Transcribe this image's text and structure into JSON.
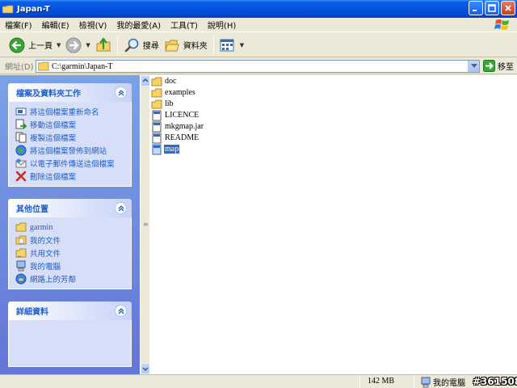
{
  "window": {
    "title": "Japan-T"
  },
  "menubar": {
    "items": [
      "檔案(F)",
      "編輯(E)",
      "檢視(V)",
      "我的最愛(A)",
      "工具(T)",
      "說明(H)"
    ]
  },
  "toolbar": {
    "back_label": "上一頁",
    "search_label": "搜尋",
    "folders_label": "資料夾"
  },
  "addressbar": {
    "label": "網址(D)",
    "path": "C:\\garmin\\Japan-T",
    "go_label": "移至"
  },
  "taskpane": {
    "file_tasks": {
      "title": "檔案及資料夾工作",
      "items": [
        "將這個檔案重新命名",
        "移動這個檔案",
        "複製這個檔案",
        "將這個檔案發佈到網站",
        "以電子郵件傳送這個檔案",
        "刪除這個檔案"
      ]
    },
    "other_places": {
      "title": "其他位置",
      "items": [
        "garmin",
        "我的文件",
        "共用文件",
        "我的電腦",
        "網路上的芳鄰"
      ]
    },
    "details": {
      "title": "詳細資料"
    }
  },
  "files": [
    {
      "name": "doc",
      "type": "folder"
    },
    {
      "name": "examples",
      "type": "folder"
    },
    {
      "name": "lib",
      "type": "folder"
    },
    {
      "name": "LICENCE",
      "type": "file"
    },
    {
      "name": "mkgmap.jar",
      "type": "file"
    },
    {
      "name": "README",
      "type": "file"
    },
    {
      "name": "map",
      "type": "file",
      "selected": true
    }
  ],
  "statusbar": {
    "size": "142 MB",
    "location": "我的電腦"
  },
  "watermark": "#361508",
  "colors": {
    "title_blue": "#0553e0",
    "pane_link": "#215dc6",
    "selection": "#316ac5"
  }
}
